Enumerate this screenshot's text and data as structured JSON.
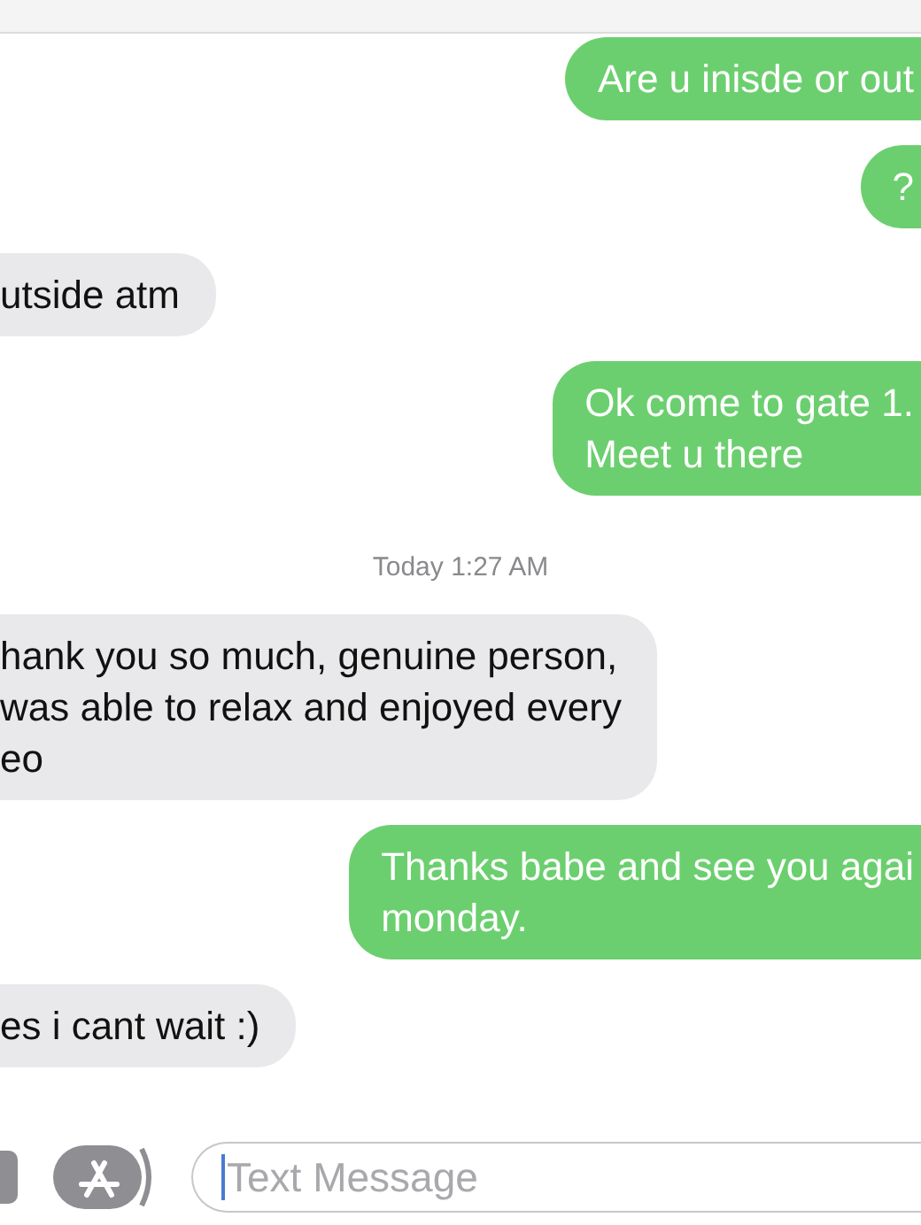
{
  "messages": [
    {
      "kind": "sent",
      "text": "Are u inisde or out"
    },
    {
      "kind": "sent",
      "text": "?"
    },
    {
      "kind": "received",
      "text": "utside atm"
    },
    {
      "kind": "sent",
      "text": "Ok come to gate 1.\nMeet u there"
    },
    {
      "kind": "timestamp",
      "text": "Today 1:27 AM"
    },
    {
      "kind": "received",
      "text": "hank you so much, genuine person,\nwas able to relax and enjoyed every\neo"
    },
    {
      "kind": "sent",
      "text": "Thanks babe and see you agai\nmonday."
    },
    {
      "kind": "received",
      "text": "es i cant wait :)"
    }
  ],
  "compose": {
    "placeholder": "Text Message"
  }
}
